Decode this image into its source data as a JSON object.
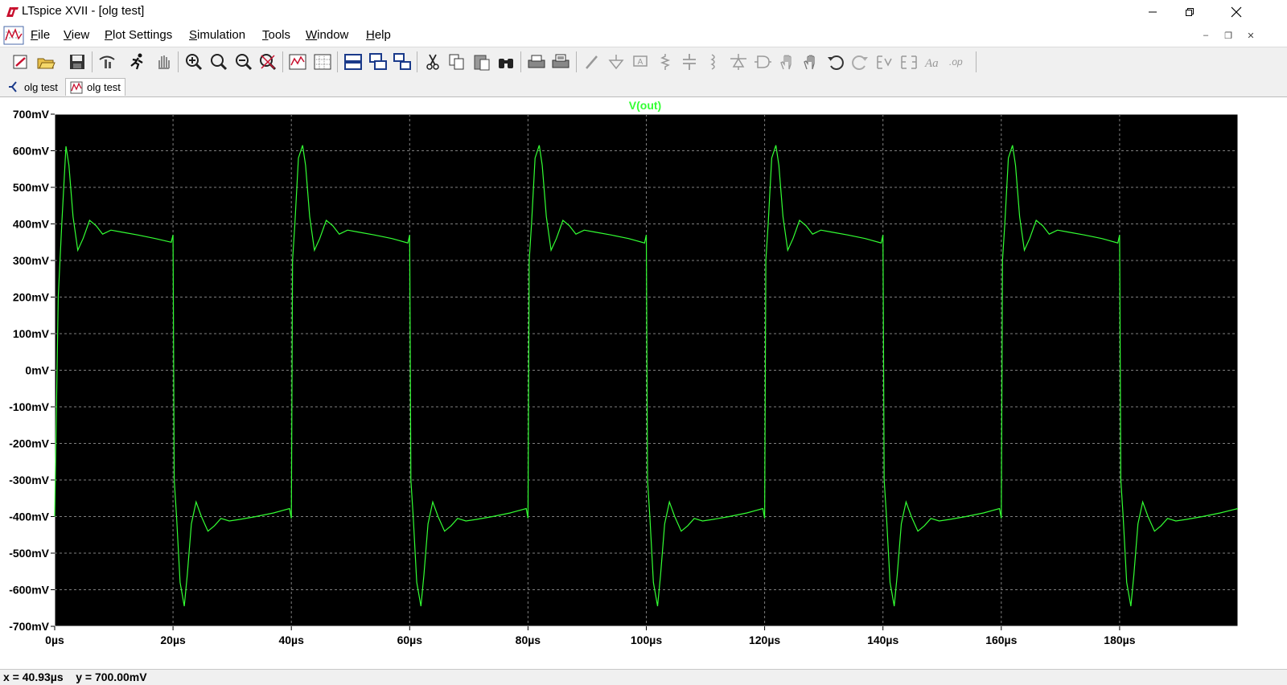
{
  "window": {
    "title": "LTspice XVII - [olg test]",
    "controls": [
      "minimize",
      "maximize",
      "close"
    ]
  },
  "menu": {
    "items": [
      {
        "label": "File",
        "hotkey": "F",
        "rest": "ile"
      },
      {
        "label": "View",
        "hotkey": "V",
        "rest": "iew"
      },
      {
        "label": "Plot Settings",
        "hotkey": "P",
        "rest": "lot Settings"
      },
      {
        "label": "Simulation",
        "hotkey": "S",
        "rest": "imulation"
      },
      {
        "label": "Tools",
        "hotkey": "T",
        "rest": "ools"
      },
      {
        "label": "Window",
        "hotkey": "W",
        "rest": "indow"
      },
      {
        "label": "Help",
        "hotkey": "H",
        "rest": "elp"
      }
    ]
  },
  "toolbar": {
    "buttons": [
      "new-schematic-icon",
      "open-icon",
      "save-icon",
      "control-panel-icon",
      "run-icon",
      "halt-icon",
      "zoom-in-icon",
      "zoom-area-icon",
      "zoom-out-icon",
      "zoom-fit-icon",
      "autorange-icon",
      "grid-icon",
      "tile-horizontal-icon",
      "cascade-icon",
      "tile-vertical-icon",
      "cut-icon",
      "copy-icon",
      "paste-icon",
      "find-icon",
      "print-icon",
      "print-preview-icon",
      "wire-icon",
      "ground-icon",
      "label-net-icon",
      "resistor-icon",
      "capacitor-icon",
      "inductor-icon",
      "diode-icon",
      "component-icon",
      "move-icon",
      "drag-icon",
      "undo-icon",
      "redo-icon",
      "rotate-icon",
      "mirror-icon",
      "text-icon",
      "spice-directive-icon"
    ]
  },
  "tabs": [
    {
      "label": "olg test",
      "kind": "schematic",
      "active": false
    },
    {
      "label": "olg test",
      "kind": "waveform",
      "active": true
    }
  ],
  "colors": {
    "plot_bg": "#000000",
    "grid": "#7f7f7f",
    "trace": "#33ff33",
    "axis_labels": "#000000"
  },
  "status": {
    "x_readout": "x = 40.93µs",
    "y_readout": "y = 700.00mV"
  },
  "chart_data": {
    "type": "line",
    "title": "V(out)",
    "xlabel": "",
    "ylabel": "",
    "xlim": [
      0,
      200
    ],
    "ylim": [
      -700,
      700
    ],
    "x_unit": "µs",
    "y_unit": "mV",
    "x_ticks": [
      "0µs",
      "20µs",
      "40µs",
      "60µs",
      "80µs",
      "100µs",
      "120µs",
      "140µs",
      "160µs",
      "180µs"
    ],
    "y_ticks": [
      "700mV",
      "600mV",
      "500mV",
      "400mV",
      "300mV",
      "200mV",
      "100mV",
      "0mV",
      "-100mV",
      "-200mV",
      "-300mV",
      "-400mV",
      "-500mV",
      "-600mV",
      "-700mV"
    ],
    "grid": true,
    "series": [
      {
        "name": "V(out)",
        "x": [
          0,
          0.6,
          1.2,
          1.9,
          2.4,
          3.1,
          3.9,
          4.8,
          5.9,
          7.0,
          8.1,
          9.5,
          11.2,
          14,
          17,
          19.7,
          20.0,
          20.2,
          20.6,
          21.2,
          21.9,
          22.4,
          23.1,
          23.9,
          24.8,
          25.9,
          27.0,
          28.1,
          29.5,
          31.2,
          34,
          37,
          39.7,
          40.0,
          40.2,
          40.6,
          41.2,
          41.9,
          42.4,
          43.1,
          43.9,
          44.8,
          45.9,
          47.0,
          48.1,
          49.5,
          51.2,
          54,
          57,
          59.7,
          60.0,
          60.2,
          60.6,
          61.2,
          61.9,
          62.4,
          63.1,
          63.9,
          64.8,
          65.9,
          67.0,
          68.1,
          69.5,
          71.2,
          74,
          77,
          79.7,
          80.0,
          80.2,
          80.6,
          81.2,
          81.9,
          82.4,
          83.1,
          83.9,
          84.8,
          85.9,
          87.0,
          88.1,
          89.5,
          91.2,
          94,
          97,
          99.7,
          100.0,
          100.2,
          100.6,
          101.2,
          101.9,
          102.4,
          103.1,
          103.9,
          104.8,
          105.9,
          107.0,
          108.1,
          109.5,
          111.2,
          114,
          117,
          119.7,
          120.0,
          120.2,
          120.6,
          121.2,
          121.9,
          122.4,
          123.1,
          123.9,
          124.8,
          125.9,
          127.0,
          128.1,
          129.5,
          131.2,
          134,
          137,
          139.7,
          140.0,
          140.2,
          140.6,
          141.2,
          141.9,
          142.4,
          143.1,
          143.9,
          144.8,
          145.9,
          147.0,
          148.1,
          149.5,
          151.2,
          154,
          157,
          159.7,
          160.0,
          160.2,
          160.6,
          161.2,
          161.9,
          162.4,
          163.1,
          163.9,
          164.8,
          165.9,
          167.0,
          168.1,
          169.5,
          171.2,
          174,
          177,
          179.7,
          180.0,
          180.2,
          180.6,
          181.2,
          181.9,
          182.4,
          183.1,
          183.9,
          184.8,
          185.9,
          187.0,
          188.1,
          189.5,
          191.2,
          194,
          197,
          200
        ],
        "y": [
          -400,
          200,
          400,
          612,
          560,
          420,
          328,
          360,
          410,
          395,
          372,
          383,
          378,
          370,
          360,
          350,
          370,
          -300,
          -400,
          -580,
          -645,
          -560,
          -420,
          -360,
          -400,
          -440,
          -425,
          -405,
          -412,
          -408,
          -400,
          -390,
          -378,
          -405,
          300,
          400,
          580,
          615,
          560,
          420,
          328,
          360,
          410,
          395,
          372,
          383,
          378,
          370,
          360,
          348,
          370,
          -300,
          -400,
          -580,
          -645,
          -560,
          -420,
          -360,
          -400,
          -440,
          -425,
          -405,
          -412,
          -408,
          -400,
          -390,
          -378,
          -405,
          300,
          400,
          580,
          615,
          560,
          420,
          328,
          360,
          410,
          395,
          372,
          383,
          378,
          370,
          360,
          348,
          370,
          -300,
          -400,
          -580,
          -645,
          -560,
          -420,
          -360,
          -400,
          -440,
          -425,
          -405,
          -412,
          -408,
          -400,
          -390,
          -378,
          -405,
          300,
          400,
          580,
          615,
          560,
          420,
          328,
          360,
          410,
          395,
          372,
          383,
          378,
          370,
          360,
          348,
          370,
          -300,
          -400,
          -580,
          -645,
          -560,
          -420,
          -360,
          -400,
          -440,
          -425,
          -405,
          -412,
          -408,
          -400,
          -390,
          -378,
          -405,
          300,
          400,
          580,
          615,
          560,
          420,
          328,
          360,
          410,
          395,
          372,
          383,
          378,
          370,
          360,
          348,
          370,
          -300,
          -400,
          -580,
          -645,
          -560,
          -420,
          -360,
          -400,
          -440,
          -425,
          -405,
          -412,
          -408,
          -400,
          -390,
          -378
        ]
      }
    ]
  }
}
